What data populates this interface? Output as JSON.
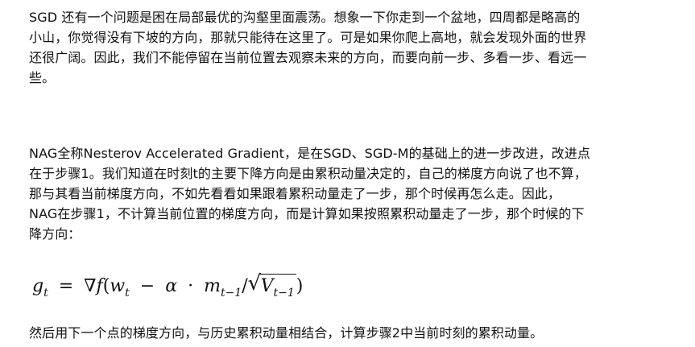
{
  "paragraph1": {
    "lines": [
      "SGD 还有一个问题是困在局部最优的沟壑里面震荡。想象一下你走到一个盆地，四周都是略高的",
      "小山，你觉得没有下坡的方向，那就只能待在这里了。可是如果你爬上高地，就会发现外面的世界",
      "还很广阔。因此，我们不能停留在当前位置去观察未来的方向，而要向前一步、多看一步、看远一",
      "些。"
    ]
  },
  "paragraph2": {
    "lines": [
      "NAG全称Nesterov Accelerated Gradient，是在SGD、SGD-M的基础上的进一步改进，改进点",
      "在于步骤1。我们知道在时刻t的主要下降方向是由累积动量决定的，自己的梯度方向说了也不算，",
      "那与其看当前梯度方向，不如先看看如果跟着累积动量走了一步，那个时候再怎么走。因此，",
      "NAG在步骤1，不计算当前位置的梯度方向，而是计算如果按照累积动量走了一步，那个时候的下",
      "降方向："
    ]
  },
  "formula": {
    "g": "g",
    "t_sub": "t",
    "equals": "=",
    "nabla_f": "∇f",
    "open": "(",
    "w": "w",
    "w_sub": "t",
    "minus": "−",
    "alpha": "α",
    "dot": "·",
    "m": "m",
    "m_sub": "t−1",
    "slash": "/",
    "radical": "√",
    "V": "V",
    "V_sub": "t−1",
    "close": ")"
  },
  "paragraph3": {
    "lines": [
      "然后用下一个点的梯度方向，与历史累积动量相结合，计算步骤2中当前时刻的累积动量。"
    ]
  }
}
